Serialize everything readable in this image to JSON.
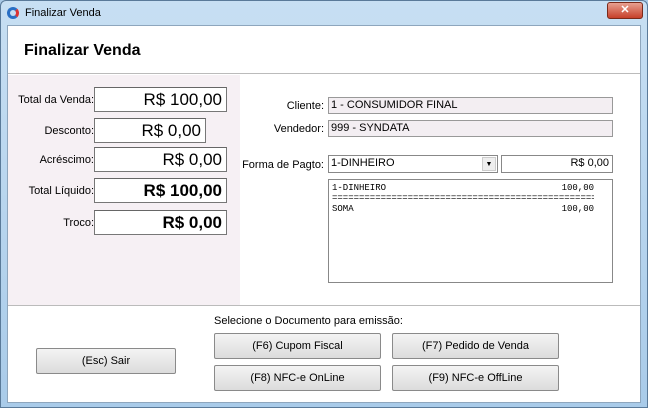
{
  "window": {
    "title": "Finalizar Venda",
    "close": "✕"
  },
  "header": {
    "title": "Finalizar Venda"
  },
  "totals": [
    {
      "label": "Total da Venda:",
      "value": "R$ 100,00",
      "bold": false
    },
    {
      "label": "Desconto:",
      "value": "R$ 0,00",
      "bold": false
    },
    {
      "label": "Acréscimo:",
      "value": "R$ 0,00",
      "bold": false
    },
    {
      "label": "Total Líquido:",
      "value": "R$ 100,00",
      "bold": true
    },
    {
      "label": "Troco:",
      "value": "R$ 0,00",
      "bold": true
    }
  ],
  "form": {
    "cliente_label": "Cliente:",
    "cliente": "1 - CONSUMIDOR FINAL",
    "vendedor_label": "Vendedor:",
    "vendedor": "999 - SYNDATA",
    "pagto_label": "Forma de Pagto:",
    "pagto": "1-DINHEIRO",
    "pagto_valor": "R$ 0,00"
  },
  "memo": {
    "lines": [
      [
        "1-DINHEIRO",
        "100,00"
      ],
      [
        "=====================================================",
        ""
      ],
      [
        "SOMA",
        "100,00"
      ]
    ]
  },
  "footer": {
    "doc_label": "Selecione o Documento para emissão:",
    "sair": "(Esc) Sair",
    "cupom": "(F6) Cupom Fiscal",
    "pedido": "(F7) Pedido de Venda",
    "nfce_on": "(F8) NFC-e OnLine",
    "nfce_off": "(F9) NFC-e OffLine"
  }
}
